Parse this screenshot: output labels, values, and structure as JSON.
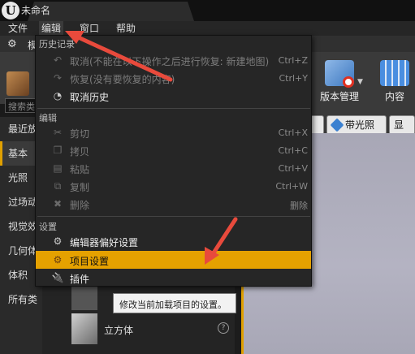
{
  "window": {
    "tab_title": "未命名"
  },
  "menubar": {
    "file": "文件",
    "edit": "编辑",
    "window": "窗口",
    "help": "帮助"
  },
  "subtab": {
    "label": "模"
  },
  "search": {
    "placeholder": "搜索类"
  },
  "toolbar": {
    "source_control": "版本管理",
    "content": "内容"
  },
  "viewport": {
    "lit_label": "带光照",
    "show_label": "显示"
  },
  "categories": [
    "最近放",
    "基本",
    "光照",
    "过场动",
    "视觉效",
    "几何体",
    "体积",
    "所有类"
  ],
  "assets": [
    {
      "name": "立方体"
    }
  ],
  "dropdown": {
    "history_header": "历史记录",
    "history_items": [
      {
        "label": "取消(不能在以下操作之后进行恢复: 新建地图)",
        "shortcut": "Ctrl+Z",
        "enabled": false,
        "icon": "undo-icon"
      },
      {
        "label": "恢复(没有要恢复的内容)",
        "shortcut": "Ctrl+Y",
        "enabled": false,
        "icon": "redo-icon"
      },
      {
        "label": "取消历史",
        "shortcut": "",
        "enabled": true,
        "icon": "history-icon"
      }
    ],
    "edit_header": "编辑",
    "edit_items": [
      {
        "label": "剪切",
        "shortcut": "Ctrl+X",
        "enabled": false,
        "icon": "cut-icon"
      },
      {
        "label": "拷贝",
        "shortcut": "Ctrl+C",
        "enabled": false,
        "icon": "copy-icon"
      },
      {
        "label": "粘贴",
        "shortcut": "Ctrl+V",
        "enabled": false,
        "icon": "paste-icon"
      },
      {
        "label": "复制",
        "shortcut": "Ctrl+W",
        "enabled": false,
        "icon": "duplicate-icon"
      },
      {
        "label": "删除",
        "shortcut": "删除",
        "enabled": false,
        "icon": "delete-icon"
      }
    ],
    "settings_header": "设置",
    "settings_items": [
      {
        "label": "编辑器偏好设置",
        "icon": "editor-preferences-icon"
      },
      {
        "label": "项目设置",
        "icon": "project-settings-icon",
        "highlighted": true
      },
      {
        "label": "插件",
        "icon": "plugins-icon"
      }
    ]
  },
  "tooltip": {
    "text": "修改当前加载项目的设置。"
  },
  "colors": {
    "highlight": "#e5a100",
    "annotation_arrow": "#e84a3c"
  }
}
